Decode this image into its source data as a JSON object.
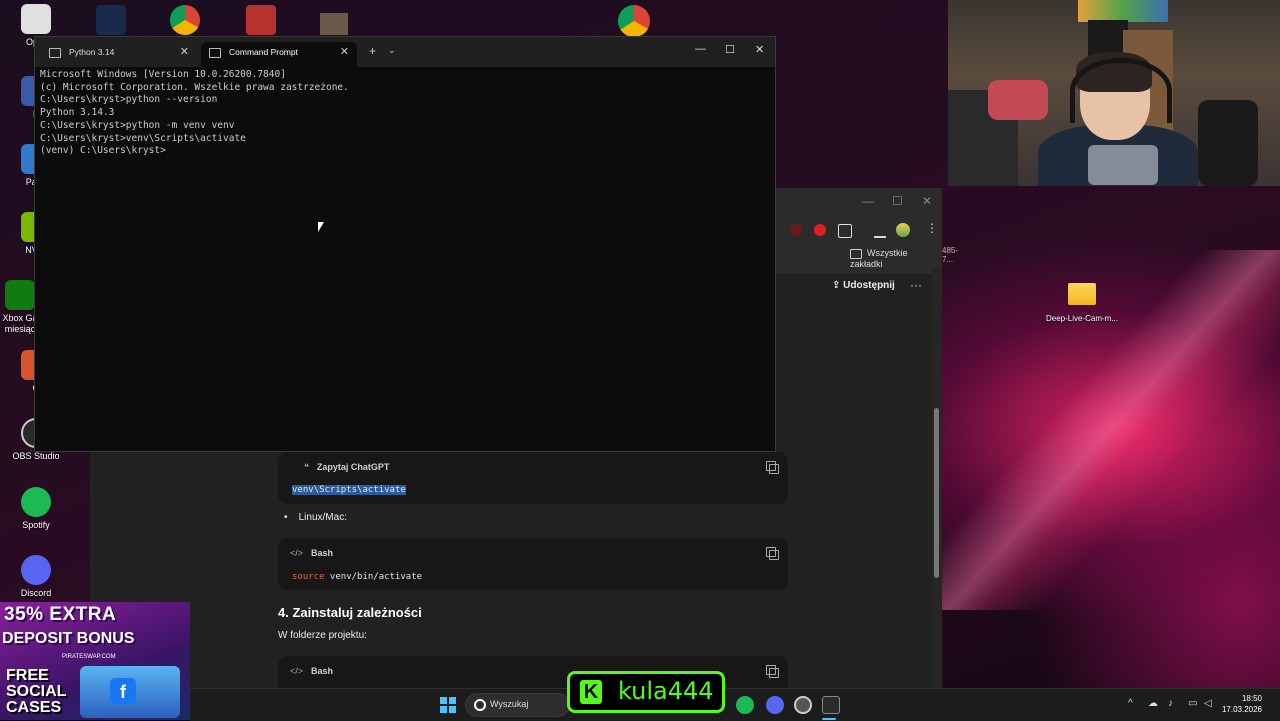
{
  "desktop": {
    "left_icons": [
      {
        "label": "Oper",
        "color": "#e0e0e0"
      },
      {
        "label": "K",
        "color": "#3a5aa8"
      },
      {
        "label": "Paint",
        "color": "#2f7bd0"
      },
      {
        "label": "NVID",
        "color": "#76b900"
      },
      {
        "label": "Xbox Ga",
        "label2": "miesiąc",
        "color": "#107c10"
      },
      {
        "label": "G",
        "color": "#d9532c"
      },
      {
        "label": "OBS Studio",
        "color": "#2a2a2a"
      },
      {
        "label": "Spotify",
        "color": "#1db954"
      },
      {
        "label": "Discord",
        "color": "#5865f2"
      }
    ],
    "right_folder": "Deep-Live-Cam-m..."
  },
  "terminal": {
    "tabs": [
      {
        "label": "Python 3.14",
        "active": false
      },
      {
        "label": "Command Prompt",
        "active": true
      }
    ],
    "new_tab": "+",
    "dropdown": "⌄",
    "controls": {
      "minimize": "—",
      "maximize": "☐",
      "close": "✕"
    },
    "lines": [
      "Microsoft Windows [Version 10.0.26200.7840]",
      "(c) Microsoft Corporation. Wszelkie prawa zastrzeżone.",
      "",
      "C:\\Users\\kryst>python --version",
      "Python 3.14.3",
      "",
      "C:\\Users\\kryst>python -m venv venv",
      "",
      "C:\\Users\\kryst>venv\\Scripts\\activate",
      "",
      "(venv) C:\\Users\\kryst>"
    ]
  },
  "browser": {
    "bookmarks_label": "Wszystkie zakładki",
    "share_label": "Udostępnij",
    "more": "···",
    "url_fragment": "485-7...",
    "ask_chatgpt": "Zapytaj ChatGPT",
    "code_blocks": [
      {
        "lang": "",
        "code": "venv\\Scripts\\activate"
      },
      {
        "lang": "Bash",
        "code_kw": "source",
        "code": " venv/bin/activate"
      },
      {
        "lang": "Bash",
        "code": ""
      }
    ],
    "bullet_linux": "Linux/Mac:",
    "heading_4": "4. Zainstaluj zależności",
    "paragraph": "W folderze projektu:"
  },
  "ad": {
    "line1": "35% EXTRA",
    "line2": "DEPOSIT BONUS",
    "site": "PIRATESWAP.COM",
    "line3": "FREE",
    "line4": "SOCIAL",
    "line5": "CASES",
    "fb": "f"
  },
  "kick": {
    "logo": "K",
    "name": "kula444"
  },
  "taskbar": {
    "search_placeholder": "Wyszukaj",
    "tray_chevron": "^",
    "clock_time": "18:50",
    "clock_date": "17.03.2026"
  }
}
